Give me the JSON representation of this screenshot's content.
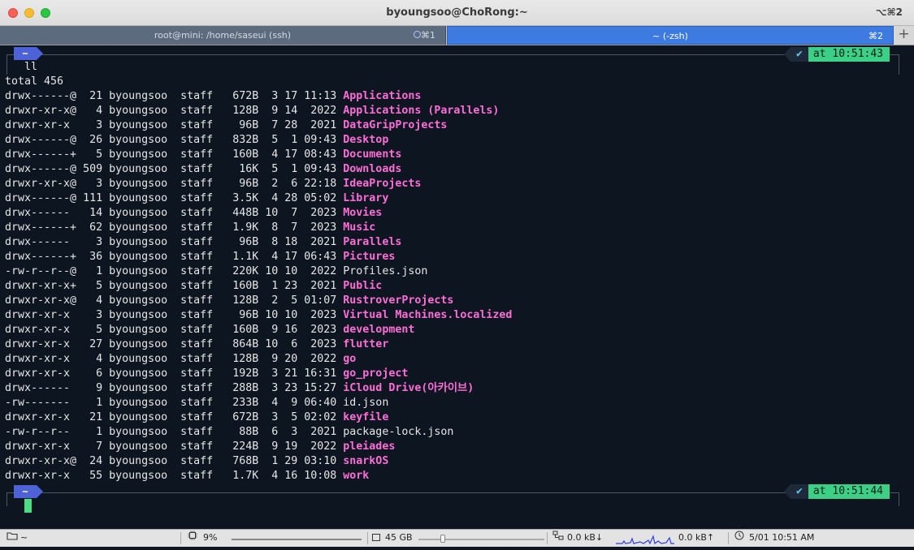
{
  "window": {
    "title": "byoungsoo@ChoRong:~",
    "shortcut": "⌥⌘2"
  },
  "tabs": [
    {
      "label": "root@mini: /home/saseui (ssh)",
      "shortcut": "⌘1"
    },
    {
      "label": "~ (-zsh)",
      "shortcut": "⌘2"
    }
  ],
  "tab_add_label": "+",
  "prompt1": {
    "dir": "~",
    "check": "✔",
    "time": "at 10:51:43",
    "command": "ll"
  },
  "total_line": "total 456",
  "listing": [
    {
      "meta": "drwx------@  21 byoungsoo  staff   672B  3 17 11:13 ",
      "name": "Applications",
      "is_dir": true
    },
    {
      "meta": "drwxr-xr-x@   4 byoungsoo  staff   128B  9 14  2022 ",
      "name": "Applications (Parallels)",
      "is_dir": true
    },
    {
      "meta": "drwxr-xr-x    3 byoungsoo  staff    96B  7 28  2021 ",
      "name": "DataGripProjects",
      "is_dir": true
    },
    {
      "meta": "drwx------@  26 byoungsoo  staff   832B  5  1 09:43 ",
      "name": "Desktop",
      "is_dir": true
    },
    {
      "meta": "drwx------+   5 byoungsoo  staff   160B  4 17 08:43 ",
      "name": "Documents",
      "is_dir": true
    },
    {
      "meta": "drwx------@ 509 byoungsoo  staff    16K  5  1 09:43 ",
      "name": "Downloads",
      "is_dir": true
    },
    {
      "meta": "drwxr-xr-x@   3 byoungsoo  staff    96B  2  6 22:18 ",
      "name": "IdeaProjects",
      "is_dir": true
    },
    {
      "meta": "drwx------@ 111 byoungsoo  staff   3.5K  4 28 05:02 ",
      "name": "Library",
      "is_dir": true
    },
    {
      "meta": "drwx------   14 byoungsoo  staff   448B 10  7  2023 ",
      "name": "Movies",
      "is_dir": true
    },
    {
      "meta": "drwx------+  62 byoungsoo  staff   1.9K  8  7  2023 ",
      "name": "Music",
      "is_dir": true
    },
    {
      "meta": "drwx------    3 byoungsoo  staff    96B  8 18  2021 ",
      "name": "Parallels",
      "is_dir": true
    },
    {
      "meta": "drwx------+  36 byoungsoo  staff   1.1K  4 17 06:43 ",
      "name": "Pictures",
      "is_dir": true
    },
    {
      "meta": "-rw-r--r--@   1 byoungsoo  staff   220K 10 10  2022 ",
      "name": "Profiles.json",
      "is_dir": false
    },
    {
      "meta": "drwxr-xr-x+   5 byoungsoo  staff   160B  1 23  2021 ",
      "name": "Public",
      "is_dir": true
    },
    {
      "meta": "drwxr-xr-x@   4 byoungsoo  staff   128B  2  5 01:07 ",
      "name": "RustroverProjects",
      "is_dir": true
    },
    {
      "meta": "drwxr-xr-x    3 byoungsoo  staff    96B 10 10  2023 ",
      "name": "Virtual Machines.localized",
      "is_dir": true
    },
    {
      "meta": "drwxr-xr-x    5 byoungsoo  staff   160B  9 16  2023 ",
      "name": "development",
      "is_dir": true
    },
    {
      "meta": "drwxr-xr-x   27 byoungsoo  staff   864B 10  6  2023 ",
      "name": "flutter",
      "is_dir": true
    },
    {
      "meta": "drwxr-xr-x    4 byoungsoo  staff   128B  9 20  2022 ",
      "name": "go",
      "is_dir": true
    },
    {
      "meta": "drwxr-xr-x    6 byoungsoo  staff   192B  3 21 16:31 ",
      "name": "go_project",
      "is_dir": true
    },
    {
      "meta": "drwx------    9 byoungsoo  staff   288B  3 23 15:27 ",
      "name": "iCloud Drive(아카이브)",
      "is_dir": true
    },
    {
      "meta": "-rw-------    1 byoungsoo  staff   233B  4  9 06:40 ",
      "name": "id.json",
      "is_dir": false
    },
    {
      "meta": "drwxr-xr-x   21 byoungsoo  staff   672B  3  5 02:02 ",
      "name": "keyfile",
      "is_dir": true
    },
    {
      "meta": "-rw-r--r--    1 byoungsoo  staff    88B  6  3  2021 ",
      "name": "package-lock.json",
      "is_dir": false
    },
    {
      "meta": "drwxr-xr-x    7 byoungsoo  staff   224B  9 19  2022 ",
      "name": "pleiades",
      "is_dir": true
    },
    {
      "meta": "drwxr-xr-x@  24 byoungsoo  staff   768B  1 29 03:10 ",
      "name": "snarkOS",
      "is_dir": true
    },
    {
      "meta": "drwxr-xr-x   55 byoungsoo  staff   1.7K  4 16 10:08 ",
      "name": "work",
      "is_dir": true
    }
  ],
  "prompt2": {
    "dir": "~",
    "check": "✔",
    "time": "at 10:51:44"
  },
  "statusbar": {
    "folder": "~",
    "cpu": "9%",
    "disk": "45 GB",
    "net_down": "0.0 kB↓",
    "net_up": "0.0 kB↑",
    "clock": "5/01 10:51 AM"
  },
  "colors": {
    "dir": "#ff6ed8",
    "time_badge": "#3ccf86",
    "dir_badge": "#4c62d6",
    "cursor": "#4ade80",
    "active_tab": "#3d7be0"
  }
}
